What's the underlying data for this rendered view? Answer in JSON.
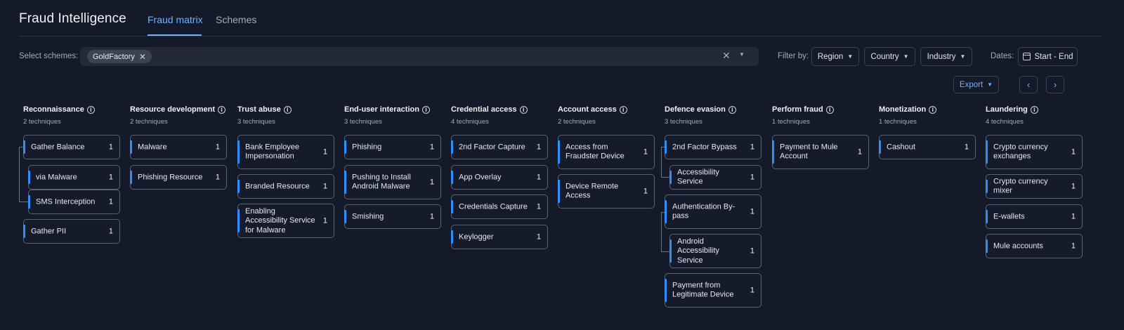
{
  "header": {
    "title": "Fraud Intelligence",
    "tabs": [
      {
        "label": "Fraud matrix",
        "active": true
      },
      {
        "label": "Schemes",
        "active": false
      }
    ]
  },
  "filters": {
    "select_schemes_label": "Select schemes:",
    "selected_chip": "GoldFactory",
    "filter_by_label": "Filter by:",
    "region": "Region",
    "country": "Country",
    "industry": "Industry",
    "dates_label": "Dates:",
    "date_range": "Start - End"
  },
  "toolbar": {
    "export_label": "Export"
  },
  "colors": {
    "accent": "#2f8fff",
    "tab_active": "#6fb3ff",
    "background": "#141a29",
    "card_border": "#5a6274"
  },
  "columns": [
    {
      "title": "Reconnaissance",
      "subtitle": "2 techniques",
      "cards": [
        {
          "label": "Gather Balance",
          "count": "1"
        },
        {
          "label": "via Malware",
          "count": "1"
        },
        {
          "label": "SMS Interception",
          "count": "1"
        },
        {
          "label": "Gather PII",
          "count": "1"
        }
      ]
    },
    {
      "title": "Resource development",
      "subtitle": "2 techniques",
      "cards": [
        {
          "label": "Malware",
          "count": "1"
        },
        {
          "label": "Phishing Resource",
          "count": "1"
        }
      ]
    },
    {
      "title": "Trust abuse",
      "subtitle": "3 techniques",
      "cards": [
        {
          "label": "Bank Employee Impersonation",
          "count": "1"
        },
        {
          "label": "Branded Resource",
          "count": "1"
        },
        {
          "label": "Enabling Accessibility Service for Malware",
          "count": "1"
        }
      ]
    },
    {
      "title": "End-user interaction",
      "subtitle": "3 techniques",
      "cards": [
        {
          "label": "Phishing",
          "count": "1"
        },
        {
          "label": "Pushing to Install Android Malware",
          "count": "1"
        },
        {
          "label": "Smishing",
          "count": "1"
        }
      ]
    },
    {
      "title": "Credential access",
      "subtitle": "4 techniques",
      "cards": [
        {
          "label": "2nd Factor Capture",
          "count": "1"
        },
        {
          "label": "App Overlay",
          "count": "1"
        },
        {
          "label": "Credentials Capture",
          "count": "1"
        },
        {
          "label": "Keylogger",
          "count": "1"
        }
      ]
    },
    {
      "title": "Account access",
      "subtitle": "2 techniques",
      "cards": [
        {
          "label": "Access from Fraudster Device",
          "count": "1"
        },
        {
          "label": "Device Remote Access",
          "count": "1"
        }
      ]
    },
    {
      "title": "Defence evasion",
      "subtitle": "3 techniques",
      "cards": [
        {
          "label": "2nd Factor Bypass",
          "count": "1"
        },
        {
          "label": "Accessibility Service",
          "count": "1"
        },
        {
          "label": "Authentication By-pass",
          "count": "1"
        },
        {
          "label": "Android Accessibility Service",
          "count": "1"
        },
        {
          "label": "Payment from Legitimate Device",
          "count": "1"
        }
      ]
    },
    {
      "title": "Perform fraud",
      "subtitle": "1 techniques",
      "cards": [
        {
          "label": "Payment to Mule Account",
          "count": "1"
        }
      ]
    },
    {
      "title": "Monetization",
      "subtitle": "1 techniques",
      "cards": [
        {
          "label": "Cashout",
          "count": "1"
        }
      ]
    },
    {
      "title": "Laundering",
      "subtitle": "4 techniques",
      "cards": [
        {
          "label": "Crypto currency exchanges",
          "count": "1"
        },
        {
          "label": "Crypto currency mixer",
          "count": "1"
        },
        {
          "label": "E-wallets",
          "count": "1"
        },
        {
          "label": "Mule accounts",
          "count": "1"
        }
      ]
    }
  ]
}
